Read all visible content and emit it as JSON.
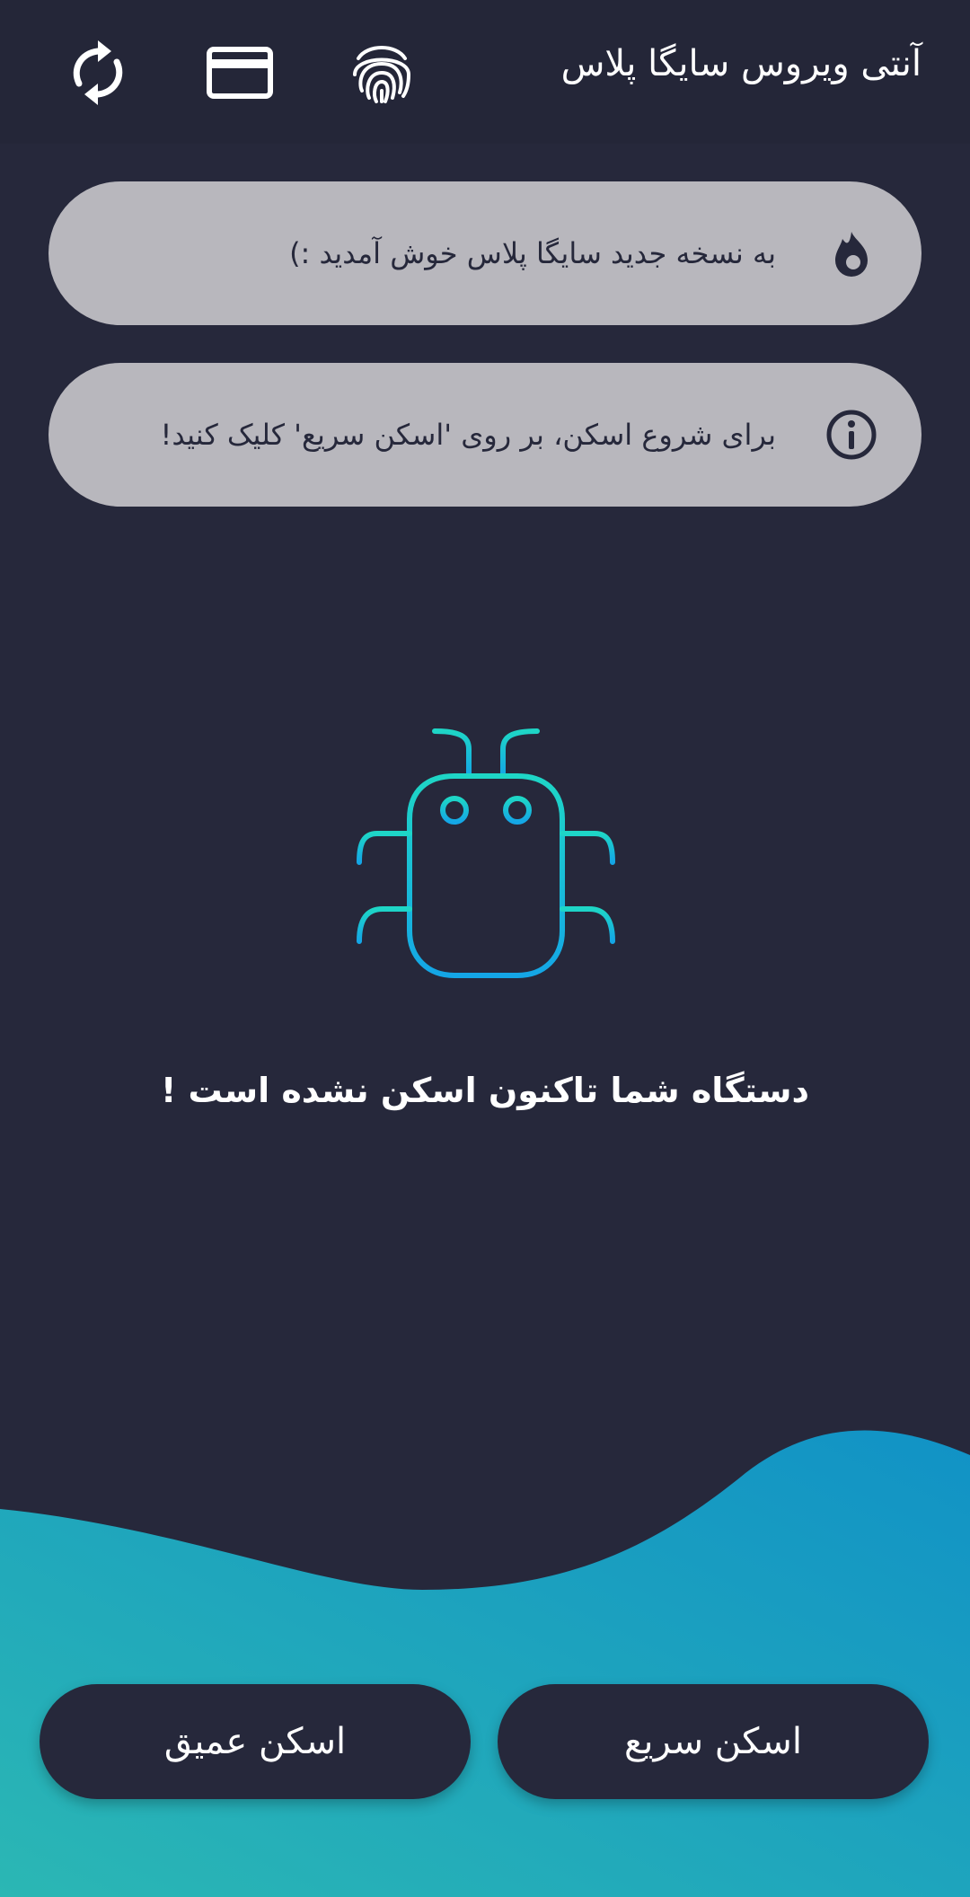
{
  "header": {
    "title": "آنتی ویروس سایگا پلاس",
    "icons": [
      "fingerprint-icon",
      "credit-card-icon",
      "sync-icon"
    ]
  },
  "cards": [
    {
      "text": "به نسخه جدید سایگا پلاس خوش آمدید :)",
      "icon": "flame-icon"
    },
    {
      "text": "برای شروع اسکن، بر روی 'اسکن سریع' کلیک کنید!",
      "icon": "info-icon"
    }
  ],
  "status": {
    "icon": "bug-icon",
    "message": "دستگاه شما تاکنون اسکن نشده است !"
  },
  "buttons": {
    "quick_scan": "اسکن سریع",
    "deep_scan": "اسکن عمیق"
  },
  "colors": {
    "background": "#26283b",
    "card": "#b8b7bd",
    "accent_start": "#2bb7b4",
    "accent_end": "#1192c6",
    "bug_gradient_top": "#1ed6c6",
    "bug_gradient_bottom": "#14a6e6"
  }
}
